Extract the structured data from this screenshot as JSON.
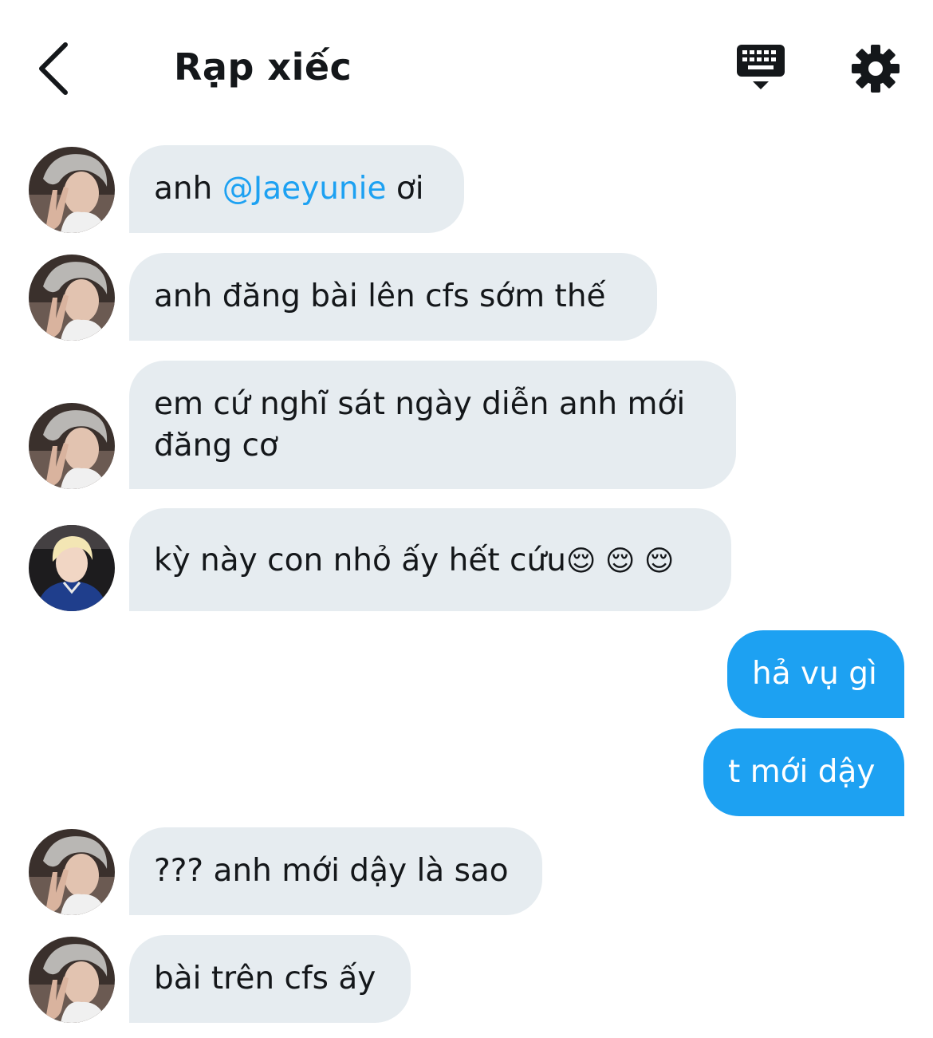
{
  "header": {
    "title": "Rạp xiếc",
    "back_icon": "chevron-left-icon",
    "keyboard_icon": "keyboard-icon",
    "settings_icon": "gear-icon"
  },
  "colors": {
    "incoming_bubble": "#e6ecf0",
    "outgoing_bubble": "#1da1f2",
    "mention": "#1da1f2",
    "text": "#14171a"
  },
  "messages": [
    {
      "direction": "incoming",
      "avatar": "gray-hair-user-avatar",
      "prefix": "anh ",
      "mention": "@Jaeyunie",
      "suffix": " ơi"
    },
    {
      "direction": "incoming",
      "avatar": "gray-hair-user-avatar",
      "text": "anh đăng bài lên cfs sớm thế"
    },
    {
      "direction": "incoming",
      "avatar": "gray-hair-user-avatar",
      "line1": "em cứ nghĩ sát ngày diễn anh mới",
      "line2": "đăng cơ"
    },
    {
      "direction": "incoming",
      "avatar": "blonde-user-avatar",
      "text": "kỳ này con nhỏ ấy hết cứu",
      "emoji": "😌 😌 😌"
    },
    {
      "direction": "outgoing",
      "text": "hả vụ gì"
    },
    {
      "direction": "outgoing",
      "text": "t mới dậy"
    },
    {
      "direction": "incoming",
      "avatar": "gray-hair-user-avatar",
      "text": "??? anh mới dậy là sao"
    },
    {
      "direction": "incoming",
      "avatar": "gray-hair-user-avatar",
      "text": "bài trên cfs ấy"
    }
  ]
}
